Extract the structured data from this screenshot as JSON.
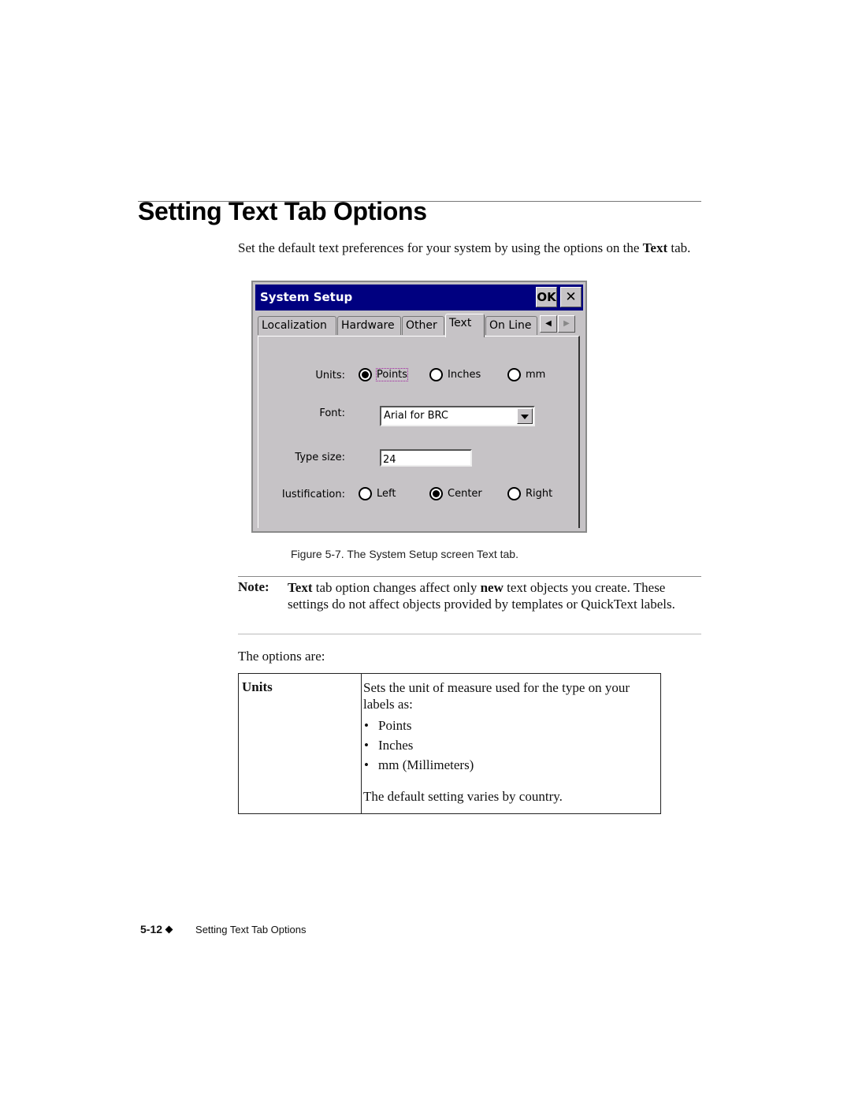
{
  "page": {
    "title": "Setting Text Tab Options",
    "intro": {
      "before": "Set the default text preferences for your system by using the options on the ",
      "bold": "Text",
      "after": " tab."
    }
  },
  "dialog": {
    "title": "System Setup",
    "ok_label": "OK",
    "close_label": "✕",
    "colors": {
      "titlebar": "#000080",
      "face": "#c6c3c6"
    },
    "tabs": [
      {
        "label": "Localization",
        "active": false
      },
      {
        "label": "Hardware",
        "active": false
      },
      {
        "label": "Other",
        "active": false
      },
      {
        "label": "Text",
        "active": true
      },
      {
        "label": "On Line",
        "active": false
      }
    ],
    "tab_scroll": {
      "left": "◀",
      "right": "▶"
    },
    "units": {
      "label": "Units:",
      "options": [
        "Points",
        "Inches",
        "mm"
      ],
      "selected": "Points"
    },
    "font": {
      "label": "Font:",
      "value": "Arial for BRC"
    },
    "type_size": {
      "label": "Type size:",
      "value": "24"
    },
    "justification": {
      "label": "Iustification:",
      "options": [
        "Left",
        "Center",
        "Right"
      ],
      "selected": "Center"
    }
  },
  "figure_caption": "Figure 5-7. The System Setup screen Text tab.",
  "note": {
    "label": "Note:",
    "bold1": "Text",
    "text1": " tab option changes affect only ",
    "bold2": "new",
    "text2": " text objects you create. These settings do not affect objects provided by templates or QuickText labels."
  },
  "options_intro": "The options are:",
  "options_table": [
    {
      "name": "Units",
      "description": "Sets the unit of measure used for the type on your labels as:",
      "bullets": [
        "Points",
        "Inches",
        "mm (Millimeters)"
      ],
      "footer": "The default setting varies by country."
    }
  ],
  "footer": {
    "page_number": "5-12",
    "running_title": "Setting Text Tab Options"
  }
}
